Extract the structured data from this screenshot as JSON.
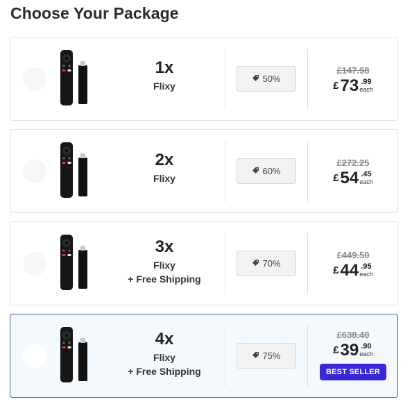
{
  "page": {
    "title": "Choose Your Package"
  },
  "packages": [
    {
      "qty": "1x",
      "name": "Flixy",
      "shipping": "",
      "discount": "50%",
      "old_price": "£147.98",
      "currency": "£",
      "price_main": "73",
      "price_cents": ".99",
      "each": "each",
      "badge": ""
    },
    {
      "qty": "2x",
      "name": "Flixy",
      "shipping": "",
      "discount": "60%",
      "old_price": "£272.25",
      "currency": "£",
      "price_main": "54",
      "price_cents": ".45",
      "each": "each",
      "badge": ""
    },
    {
      "qty": "3x",
      "name": "Flixy",
      "shipping": "+ Free Shipping",
      "discount": "70%",
      "old_price": "£449.50",
      "currency": "£",
      "price_main": "44",
      "price_cents": ".95",
      "each": "each",
      "badge": ""
    },
    {
      "qty": "4x",
      "name": "Flixy",
      "shipping": "+ Free Shipping",
      "discount": "75%",
      "old_price": "£638.40",
      "currency": "£",
      "price_main": "39",
      "price_cents": ".90",
      "each": "each",
      "badge": "BEST SELLER"
    }
  ],
  "colors": {
    "accent": "#3a27d8",
    "selected_border": "#4a5fa6",
    "selected_bg": "#f4f9fd"
  },
  "icons": {
    "discount": "tag-icon",
    "product": "remote-and-stick-image"
  }
}
